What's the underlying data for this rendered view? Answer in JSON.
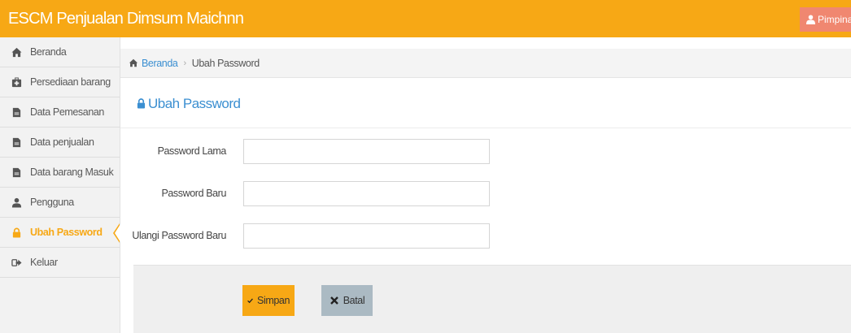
{
  "app": {
    "title": "ESCM Penjualan Dimsum Maichnn",
    "user_label": "Pimpinan"
  },
  "sidebar": {
    "items": [
      {
        "label": "Beranda",
        "icon": "home-icon"
      },
      {
        "label": "Persediaan barang",
        "icon": "medkit-icon"
      },
      {
        "label": "Data Pemesanan",
        "icon": "file-icon"
      },
      {
        "label": "Data penjualan",
        "icon": "file-icon"
      },
      {
        "label": "Data barang Masuk",
        "icon": "file-icon"
      },
      {
        "label": "Pengguna",
        "icon": "user-icon"
      },
      {
        "label": "Ubah Password",
        "icon": "lock-icon",
        "active": true
      },
      {
        "label": "Keluar",
        "icon": "sign-out-icon"
      }
    ]
  },
  "breadcrumb": {
    "home": "Beranda",
    "current": "Ubah Password"
  },
  "page": {
    "title": "Ubah Password"
  },
  "form": {
    "old_password_label": "Password Lama",
    "new_password_label": "Password Baru",
    "repeat_password_label": "Ulangi Password Baru",
    "old_password_value": "",
    "new_password_value": "",
    "repeat_password_value": "",
    "save_label": "Simpan",
    "cancel_label": "Batal"
  },
  "colors": {
    "accent": "#f7a815",
    "link": "#3b8fd1",
    "user_badge": "#f08770",
    "cancel_button": "#abbac3"
  }
}
